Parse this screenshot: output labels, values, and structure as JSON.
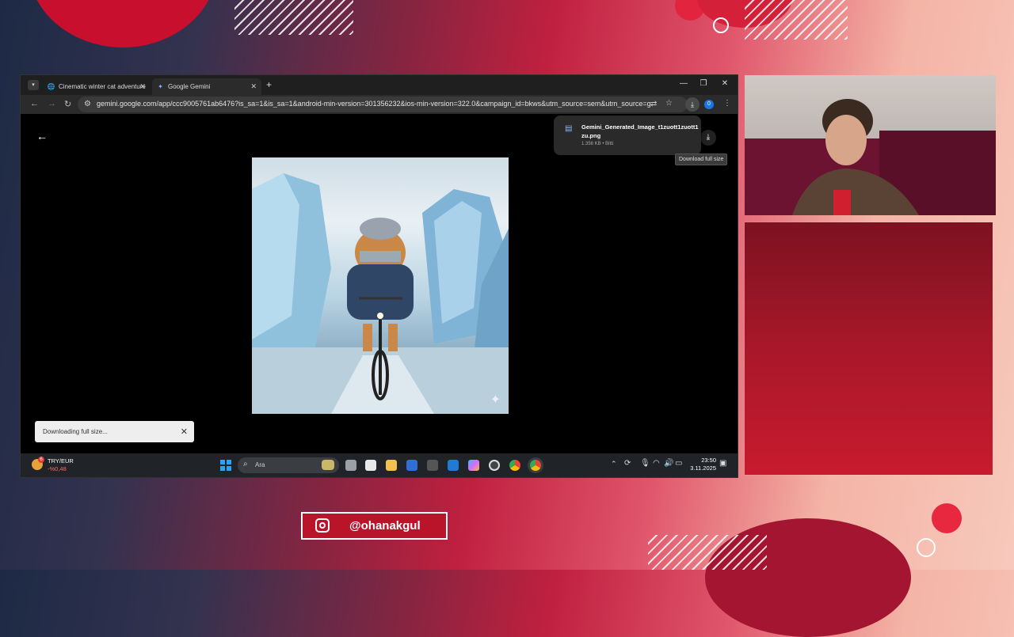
{
  "browser": {
    "tabs": [
      {
        "label": "Cinematic winter cat adventure",
        "icon": "globe-icon"
      },
      {
        "label": "Google Gemini",
        "icon": "gemini-icon"
      }
    ],
    "new_tab": "+",
    "url": "gemini.google.com/app/ccc9005761ab6476?is_sa=1&is_sa=1&android-min-version=301356232&ios-min-version=322.0&campaign_id=bkws&utm_source=sem&utm_source=google&utm_...",
    "download_badge": "0"
  },
  "download_panel": {
    "filename_line1": "Gemini_Generated_Image_t1zuott1zuott1",
    "filename_line2": "zu.png",
    "meta": "1.356 KB • Bitti"
  },
  "tooltip": "Download full size",
  "snackbar": {
    "text": "Downloading full size...",
    "close": "✕"
  },
  "taskbar": {
    "ticker_symbol": "TRY/EUR",
    "ticker_change": "-%0,48",
    "ticker_badge": "6",
    "search_placeholder": "Ara",
    "time": "23:50",
    "date": "3.11.2025"
  },
  "social": {
    "handle": "@ohanakgul"
  },
  "colors": {
    "brand_red": "#b9142a",
    "chrome_dark": "#1f1f1f",
    "ticker_negative": "#ff6b6b"
  }
}
